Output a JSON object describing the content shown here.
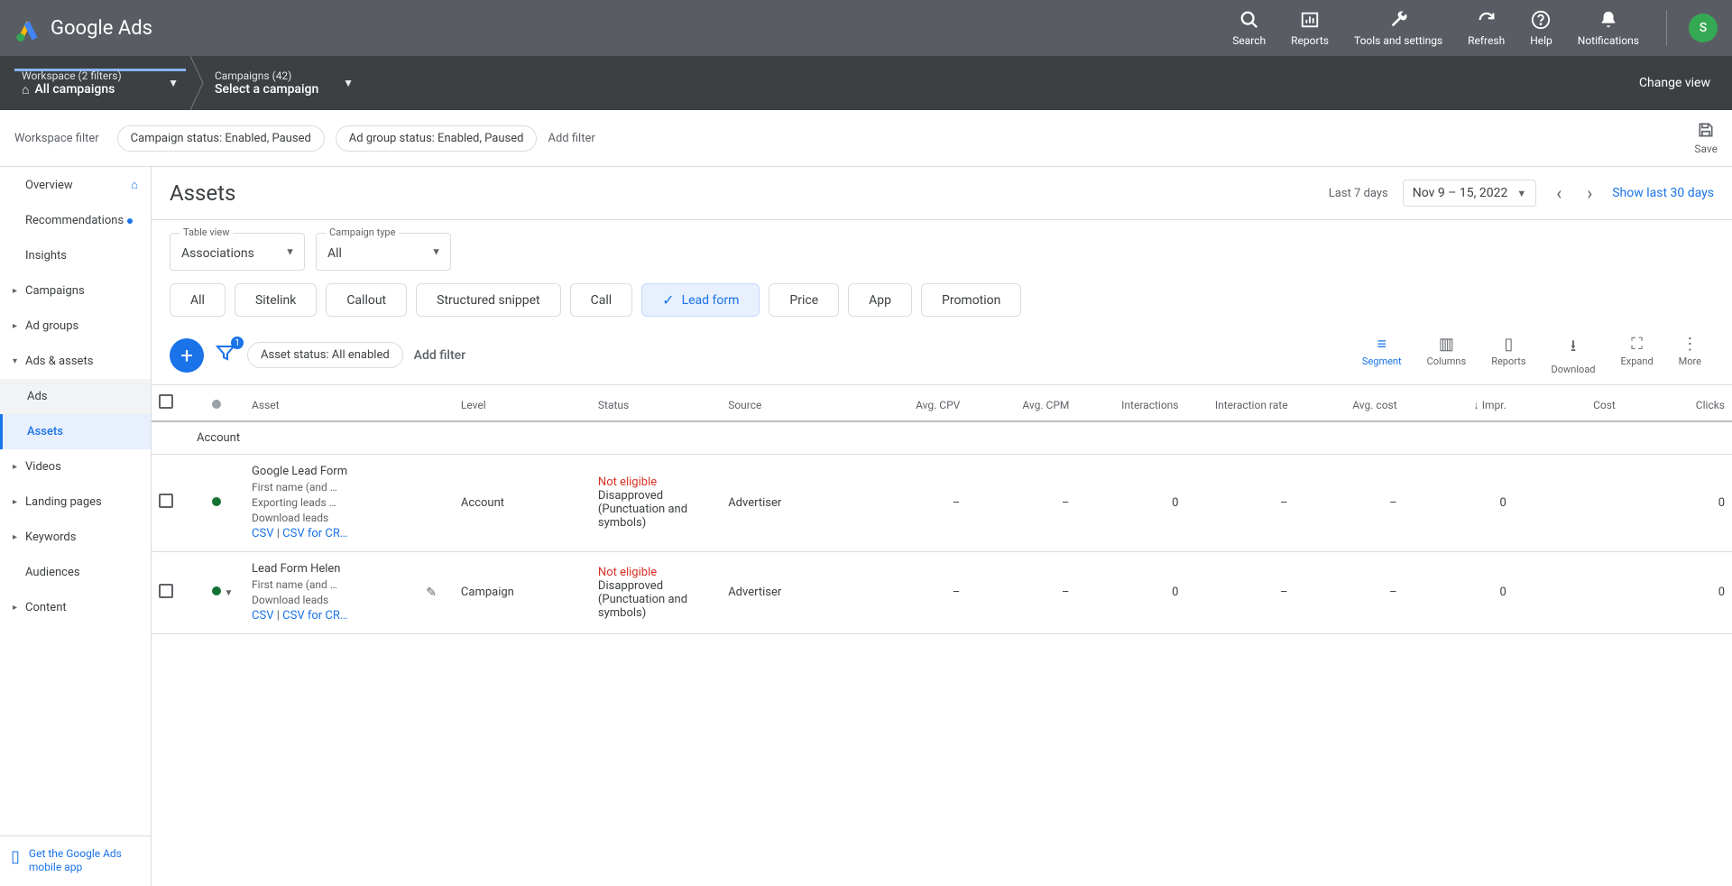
{
  "header": {
    "product": "Google Ads",
    "tools": {
      "search": "Search",
      "reports": "Reports",
      "tools_settings": "Tools and settings",
      "refresh": "Refresh",
      "help": "Help",
      "notifications": "Notifications"
    },
    "avatar_letter": "S"
  },
  "breadcrumb": {
    "workspace_label": "Workspace (2 filters)",
    "workspace_value": "All campaigns",
    "campaigns_label": "Campaigns (42)",
    "campaigns_value": "Select a campaign",
    "change_view": "Change view"
  },
  "filter_bar": {
    "label": "Workspace filter",
    "chip1": "Campaign status: Enabled, Paused",
    "chip2": "Ad group status: Enabled, Paused",
    "add_filter": "Add filter",
    "save": "Save"
  },
  "sidebar": {
    "overview": "Overview",
    "recommendations": "Recommendations",
    "insights": "Insights",
    "campaigns": "Campaigns",
    "ad_groups": "Ad groups",
    "ads_assets": "Ads & assets",
    "ads": "Ads",
    "assets": "Assets",
    "videos": "Videos",
    "landing_pages": "Landing pages",
    "keywords": "Keywords",
    "audiences": "Audiences",
    "content": "Content",
    "footer": "Get the Google Ads mobile app"
  },
  "page": {
    "title": "Assets",
    "last7": "Last 7 days",
    "date_range": "Nov 9 – 15, 2022",
    "show30": "Show last 30 days"
  },
  "selects": {
    "table_view_label": "Table view",
    "table_view_value": "Associations",
    "campaign_type_label": "Campaign type",
    "campaign_type_value": "All"
  },
  "pills": {
    "all": "All",
    "sitelink": "Sitelink",
    "callout": "Callout",
    "structured": "Structured snippet",
    "call": "Call",
    "lead_form": "Lead form",
    "price": "Price",
    "app": "App",
    "promotion": "Promotion"
  },
  "toolbar": {
    "filter_badge": "1",
    "asset_status_chip": "Asset status: All enabled",
    "add_filter": "Add filter",
    "segment": "Segment",
    "columns": "Columns",
    "reports": "Reports",
    "download": "Download",
    "expand": "Expand",
    "more": "More"
  },
  "table": {
    "headers": {
      "asset": "Asset",
      "level": "Level",
      "status": "Status",
      "source": "Source",
      "avg_cpv": "Avg. CPV",
      "avg_cpm": "Avg. CPM",
      "interactions": "Interactions",
      "interaction_rate": "Interaction rate",
      "avg_cost": "Avg. cost",
      "impr": "Impr.",
      "cost": "Cost",
      "clicks": "Clicks"
    },
    "section": "Account",
    "rows": [
      {
        "name": "Google Lead Form",
        "sub": "First name (and …",
        "exporting": "Exporting leads …",
        "download": "Download leads",
        "csv": "CSV",
        "csv_crm": "CSV for CR…",
        "level": "Account",
        "status_line1": "Not eligible",
        "status_line2": "Disapproved (Punctuation and symbols)",
        "source": "Advertiser",
        "avg_cpv": "–",
        "avg_cpm": "–",
        "interactions": "0",
        "interaction_rate": "–",
        "avg_cost": "–",
        "impr": "0",
        "cost": "",
        "clicks": "0",
        "show_pencil": false
      },
      {
        "name": "Lead Form Helen",
        "sub": "First name (and …",
        "exporting": "",
        "download": "Download leads",
        "csv": "CSV",
        "csv_crm": "CSV for CR…",
        "level": "Campaign",
        "status_line1": "Not eligible",
        "status_line2": "Disapproved (Punctuation and symbols)",
        "source": "Advertiser",
        "avg_cpv": "–",
        "avg_cpm": "–",
        "interactions": "0",
        "interaction_rate": "–",
        "avg_cost": "–",
        "impr": "0",
        "cost": "",
        "clicks": "0",
        "show_pencil": true
      }
    ]
  }
}
